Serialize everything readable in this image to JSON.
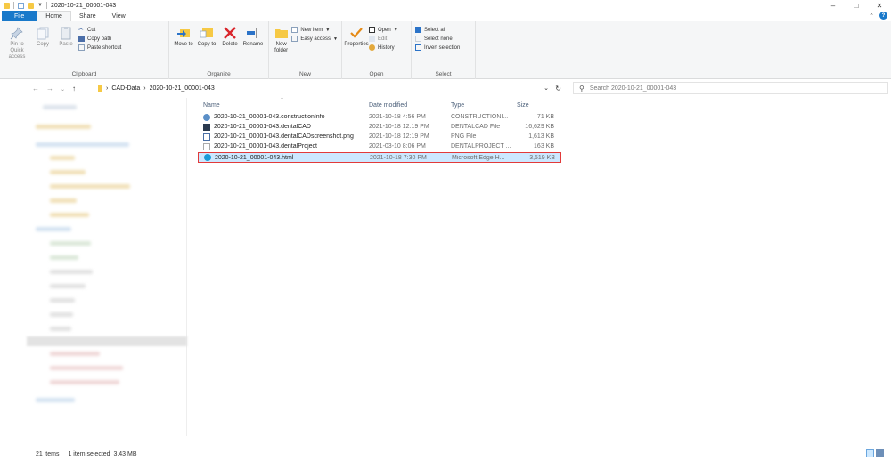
{
  "window": {
    "title": "2020-10-21_00001-043",
    "controls": {
      "minimize": "–",
      "maximize": "□",
      "close": "✕"
    },
    "help": "?"
  },
  "ribbon_tabs": [
    {
      "label": "File"
    },
    {
      "label": "Home"
    },
    {
      "label": "Share"
    },
    {
      "label": "View"
    }
  ],
  "ribbon": {
    "clipboard": {
      "label": "Clipboard",
      "pin": "Pin to Quick access",
      "copy": "Copy",
      "paste": "Paste",
      "cut": "Cut",
      "copy_path": "Copy path",
      "paste_shortcut": "Paste shortcut"
    },
    "organize": {
      "label": "Organize",
      "move_to": "Move to",
      "copy_to": "Copy to",
      "delete": "Delete",
      "rename": "Rename"
    },
    "new": {
      "label": "New",
      "new_folder": "New folder",
      "new_item": "New item",
      "easy_access": "Easy access"
    },
    "open": {
      "label": "Open",
      "properties": "Properties",
      "open": "Open",
      "edit": "Edit",
      "history": "History"
    },
    "select": {
      "label": "Select",
      "select_all": "Select all",
      "select_none": "Select none",
      "invert_selection": "Invert selection"
    }
  },
  "address": {
    "crumbs": [
      "CAD-Data",
      "2020-10-21_00001-043"
    ],
    "sep": "›",
    "search_placeholder": "Search 2020-10-21_00001-043"
  },
  "columns": {
    "name": "Name",
    "date": "Date modified",
    "type": "Type",
    "size": "Size"
  },
  "files": [
    {
      "name": "2020-10-21_00001-043.constructionInfo",
      "date": "2021-10-18 4:56 PM",
      "type": "CONSTRUCTIONI...",
      "size": "71 KB",
      "icon": "construction-file-icon",
      "color": "#5b8fc7"
    },
    {
      "name": "2020-10-21_00001-043.dentalCAD",
      "date": "2021-10-18 12:19 PM",
      "type": "DENTALCAD File",
      "size": "16,629 KB",
      "icon": "dentalcad-file-icon",
      "color": "#2b3a4f"
    },
    {
      "name": "2020-10-21_00001-043.dentalCADscreenshot.png",
      "date": "2021-10-18 12:19 PM",
      "type": "PNG File",
      "size": "1,613 KB",
      "icon": "png-file-icon",
      "color": "#4a6fa5"
    },
    {
      "name": "2020-10-21_00001-043.dentalProject",
      "date": "2021-03-10 8:06 PM",
      "type": "DENTALPROJECT ...",
      "size": "163 KB",
      "icon": "blank-file-icon",
      "color": "#ffffff"
    },
    {
      "name": "2020-10-21_00001-043.html",
      "date": "2021-10-18 7:30 PM",
      "type": "Microsoft Edge H...",
      "size": "3,519 KB",
      "icon": "edge-html-file-icon",
      "color": "#1a9bd7"
    }
  ],
  "status": {
    "items": "21 items",
    "selected": "1 item selected  3.43 MB"
  },
  "colors": {
    "accent": "#1979ca",
    "selection_bg": "#cce8ff",
    "selection_border": "#e23a3a"
  }
}
